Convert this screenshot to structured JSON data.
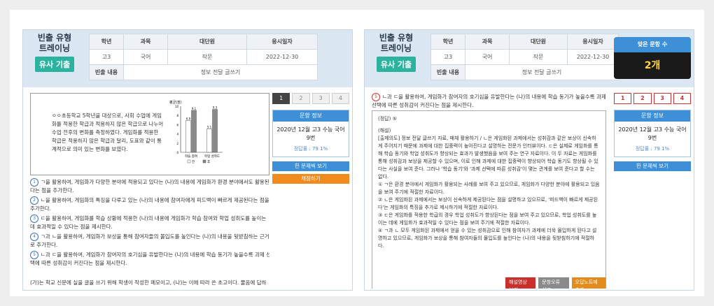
{
  "left": {
    "brand": {
      "line1": "빈출 유형",
      "line2": "트레이닝",
      "tag": "유사 기출"
    },
    "table": {
      "headers": [
        "학년",
        "과목",
        "대단원",
        "응시일자"
      ],
      "values": [
        "고3",
        "국어",
        "작문",
        "2022-12-30"
      ],
      "content_label": "빈출 내용",
      "content_value": "정보 전달 글쓰기"
    },
    "passage": "ㅇㅇ초등학교 5학년을 대상으로, 사회 수업에 게임화를 적용한 학급과 적용하지 않은 학급으로 나누어 수업 전후의 변화를 측정하였다. 게임화를 적용한 학급은 적용하지 않은 학급과 달리, 도표와 같이 통계적으로 의미 있는 변화를 보였다.",
    "chart_data": {
      "type": "bar",
      "title": "평균(점)",
      "categories": [
        "학습 참여",
        "학업 성취도"
      ],
      "series": [
        {
          "name": "전",
          "values": [
            6.9,
            5.1
          ]
        },
        {
          "name": "후",
          "values": [
            9.1,
            9.3
          ]
        }
      ],
      "ylim": [
        0,
        10
      ]
    },
    "options": [
      "ㄱ을 활용하여, 게임화가 다양한 분야에 적용되고 있다는 (나)의 내용에 게임화가 환경 분야에서도 활용된다는 점을 추가한다.",
      "ㄴ을 활용하여, 게임화의 특징을 다루고 있는 (나)의 내용에 참여자에게 피드백이 빠르게 제공된다는 점을 추가한다.",
      "ㄷ을 활용하여, 게임화를 학습 상황에 적용한 (나)의 내용에 게임화가 학습 참여와 학업 성취도를 높이는 데 효과적일 수 있다는 점을 제시한다.",
      "ㄱ과 ㄴ을 활용하여, 게임화가 보상을 통해 참여자들의 몰입도를 높인다는 (나)의 내용을 뒷받침하는 근거로 추가한다.",
      "ㄴ과 ㄷ을 활용하여, 게임화가 참여자의 호기심을 유발한다는 (나)의 내용에 학습 동기가 높을수록 과제 선택에 따른 성취감이 커진다는 점을 제시한다."
    ],
    "footer": "(가)는 학교 신문에 실을 글을 쓰기 위해 학생이 작성한 메모이고, (나)는 이에 따라 쓴 초고이다. 물음에 답하",
    "tabs": [
      "1",
      "2",
      "3",
      "4"
    ],
    "info": {
      "title": "문항 정보",
      "value": "2020년 12월 고3 수능 국어 9번",
      "rate": "정답률 : 79.1%"
    },
    "btn_view": "한 문제씩 보기",
    "btn_grade": "채점하기"
  },
  "right": {
    "brand": {
      "line1": "빈출 유형",
      "line2": "트레이닝",
      "tag": "유사 기출"
    },
    "table": {
      "headers": [
        "학년",
        "과목",
        "대단원",
        "응시일자"
      ],
      "values": [
        "고3",
        "국어",
        "작문",
        "2022-12-30"
      ],
      "content_label": "빈출 내용",
      "content_value": "정보 전달 글쓰기"
    },
    "score": {
      "label": "맞은 문항 수",
      "value": "2개"
    },
    "opt5": "ㄴ과 ㄷ을 활용하여, 게임화가 참여자의 호기심을 유발한다는 (나)의 내용에 학습 동기가 높을수록 과제 선택에 따른 성취감이 커진다는 점을 제시한다.",
    "answer": {
      "label": "(정답) ⑤",
      "explain_label": "(해설)",
      "body": "[출제의도] 정보 전달 글쓰기 자료, 매체 활용하기 / ㄴ은 게임화된 과제에서는 성취감과 같은 보상이 신속하게 주어지기 때문에 과제에 대한 집중력이 높아진다고 설명하는 전문가 인터뷰이다. ㄷ은 실제로 게임화를 통해 학습 동기와 학업 성취도가 향상되는 효과가 발생했음을 보여 주는 연구 자료이다. 이 두 자료는 게임화를 통해 성취감과 보상을 제공할 수 있으며, 이로 인해 과제에 대한 집중력이 향상되어 학습 동기도 향상될 수 있다는 사실을 보여 준다. 그러나 '학습 동기'와 '과제 선택에 따른 성취감'이 몇는 관계를 보여 준다고 할 수는 없다.",
      "items": [
        "① ㄱ은 환경 분야에서 게임화가 활용되는 사례를 보여 주고 있으므로, 게임화가 다양한 분야에 활용되고 있음을 보여 주기에 적절한 자료이다.",
        "② ㄴ은 게임화된 과제에서는 보상이 신속하게 제공된다는 점을 설명하고 있으므로, '피드백이 빠르게 제공된다'는 게임화의 특징을 추가로 제시하기에 적절한 자료이다.",
        "③ ㄷ은 게임화를 적용한 학급의 경우 학업 성취도가 향상된다는 점을 보여 주고 있으므로, 학업 성취도를 높이는 데에 게임화가 효과적일 수 있다는 점을 보여 주기에 적절한 자료이다.",
        "④ ㄱ과 ㄴ 모두 게임화된 과제에서 얻을 수 있는 성취감으로 인해 참여자가 과제에 더욱 몰입하게 된다고 설명하고 있으므로, 게임화가 보상을 통해 참여자들의 몰입도를 높인다는 (나)의 내용을 뒷받침하기에 적절하다."
      ],
      "actions": [
        "해설영상 보기",
        "문항오류 신고",
        "오답노트에 추가"
      ]
    },
    "tabs": [
      "1",
      "2",
      "3",
      "4"
    ],
    "info": {
      "title": "문항 정보",
      "value": "2020년 12월 고3 수능 국어 9번",
      "rate": "정답률 : 79.1%"
    },
    "btn_view": "한 문제씩 보기"
  }
}
